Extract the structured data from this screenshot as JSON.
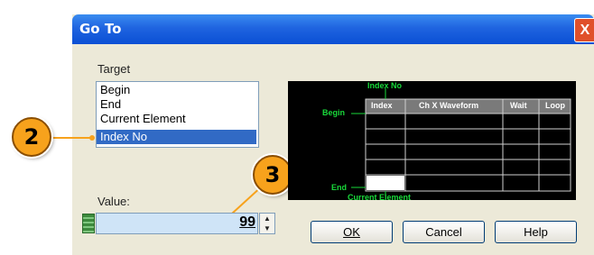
{
  "dialog": {
    "title": "Go To",
    "close_glyph": "X"
  },
  "target": {
    "label": "Target",
    "items": [
      "Begin",
      "End",
      "Current Element",
      "Index No"
    ],
    "selected_index": 3
  },
  "value": {
    "label": "Value:",
    "number": "99"
  },
  "callouts": [
    "2",
    "3"
  ],
  "diagram": {
    "top_label": "Index No",
    "begin_label": "Begin",
    "end_label": "End",
    "bottom_label": "Current Element",
    "columns": [
      "Index",
      "Ch X Waveform",
      "Wait",
      "Loop"
    ]
  },
  "buttons": {
    "ok": "OK",
    "cancel": "Cancel",
    "help": "Help"
  },
  "colors": {
    "accent": "#316ac5",
    "green": "#19d93a",
    "callout": "#f7a21c"
  }
}
